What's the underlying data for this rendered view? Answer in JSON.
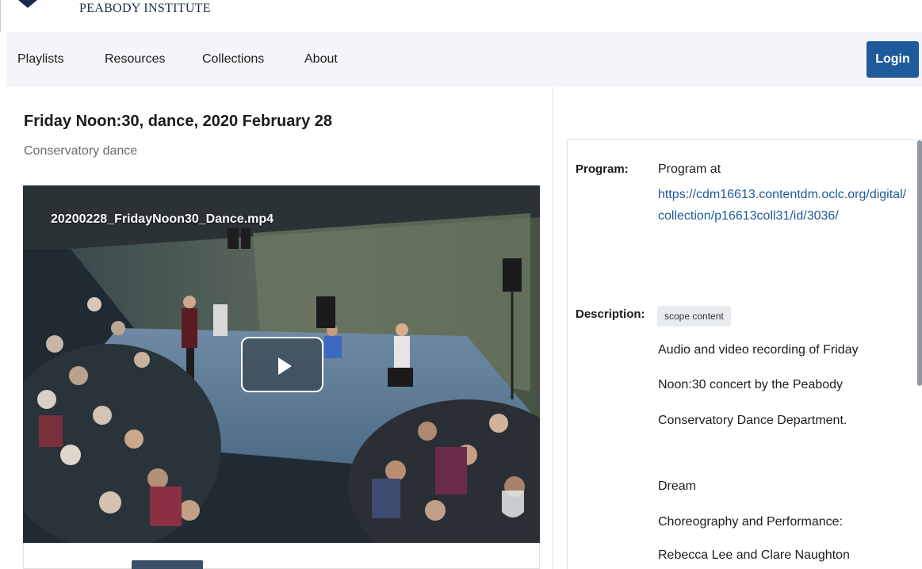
{
  "header": {
    "logo_text": "PEABODY INSTITUTE"
  },
  "nav": {
    "items": [
      {
        "label": "Playlists"
      },
      {
        "label": "Resources"
      },
      {
        "label": "Collections"
      },
      {
        "label": "About"
      }
    ],
    "login_label": "Login"
  },
  "item": {
    "title": "Friday Noon:30, dance, 2020 February 28",
    "subtitle": "Conservatory dance",
    "video_filename": "20200228_FridayNoon30_Dance.mp4"
  },
  "metadata": {
    "program_label": "Program:",
    "program_text": "Program at",
    "program_link": "https://cdm16613.contentdm.oclc.org/digital/collection/p16613coll31/id/3036/",
    "description_label": "Description:",
    "description_badge": "scope content",
    "description_lines": [
      "Audio and video recording of Friday",
      "Noon:30 concert by the Peabody",
      "Conservatory Dance Department.",
      "Dream",
      "Choreography and Performance:",
      "Rebecca Lee and Clare Naughton"
    ]
  },
  "colors": {
    "accent": "#1f5a9a",
    "navbar_bg": "#f3f5f8",
    "logo_navy": "#1a2b4c"
  },
  "icons": {
    "logo": "peabody-shield-icon",
    "play": "play-icon",
    "watermark": "peabody-watermark-icon"
  }
}
